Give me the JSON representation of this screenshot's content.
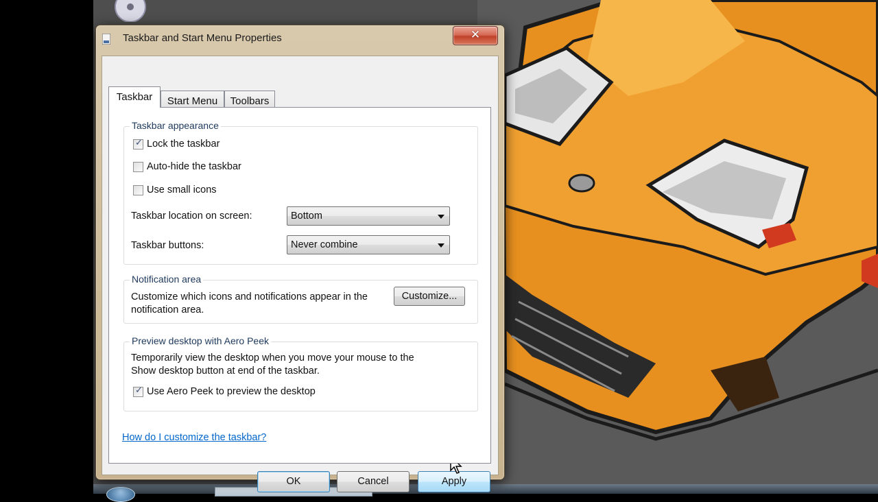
{
  "window": {
    "title": "Taskbar and Start Menu Properties",
    "close_symbol": "✕"
  },
  "tabs": [
    {
      "label": "Taskbar",
      "active": true
    },
    {
      "label": "Start Menu",
      "active": false
    },
    {
      "label": "Toolbars",
      "active": false
    }
  ],
  "appearance": {
    "title": "Taskbar appearance",
    "lock_label": "Lock the taskbar",
    "lock_checked": true,
    "autohide_label": "Auto-hide the taskbar",
    "autohide_checked": false,
    "small_icons_label": "Use small icons",
    "small_icons_checked": false,
    "location_label": "Taskbar location on screen:",
    "location_value": "Bottom",
    "buttons_label": "Taskbar buttons:",
    "buttons_value": "Never combine"
  },
  "notification": {
    "title": "Notification area",
    "description_line1": "Customize which icons and notifications appear in the",
    "description_line2": "notification area.",
    "customize_label": "Customize..."
  },
  "aero_peek": {
    "title": "Preview desktop with Aero Peek",
    "description_line1": "Temporarily view the desktop when you move your mouse to the",
    "description_line2": "Show desktop button at end of the taskbar.",
    "use_label": "Use Aero Peek to preview the desktop",
    "use_checked": true
  },
  "help_link": "How do I customize the taskbar?",
  "buttons": {
    "ok": "OK",
    "cancel": "Cancel",
    "apply": "Apply"
  },
  "check_mark": "✓",
  "colors": {
    "link": "#0066cc",
    "car_orange": "#e8901f",
    "window_frame": "#cdbb98"
  },
  "icons": [
    "cd-icon",
    "window-icon",
    "close-icon",
    "chevron-down-icon",
    "checkbox-icon",
    "mouse-cursor-icon",
    "start-orb-icon"
  ]
}
